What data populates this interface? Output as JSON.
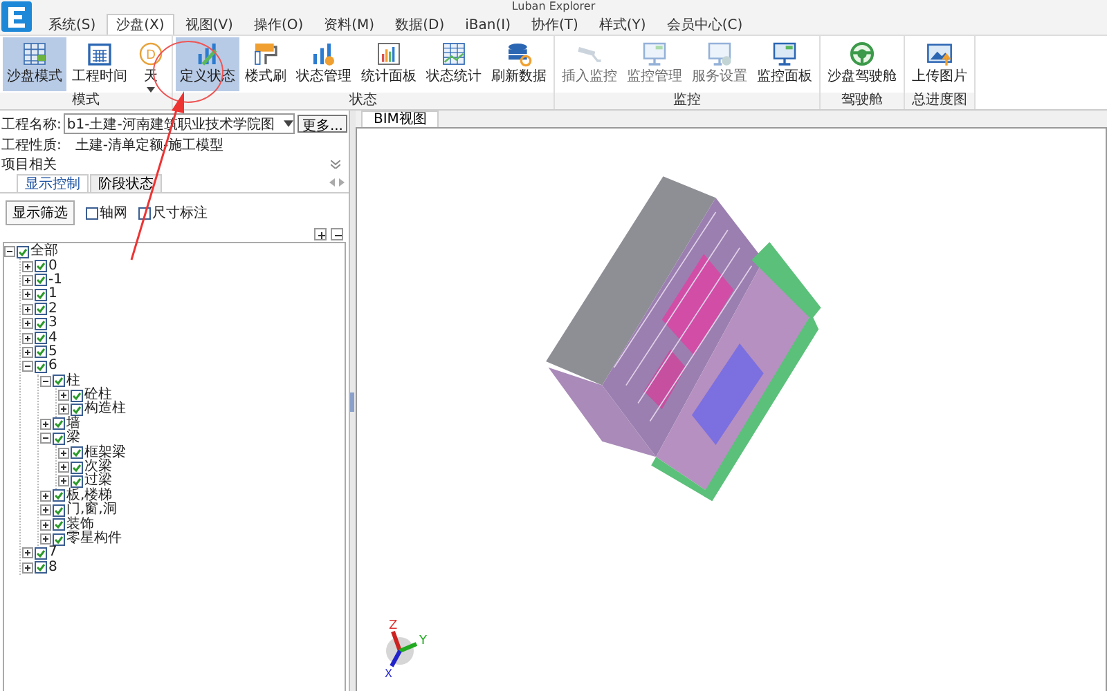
{
  "window": {
    "title": "Luban Explorer"
  },
  "menu_tabs": [
    {
      "label": "系统(S)",
      "selected": false
    },
    {
      "label": "沙盘(X)",
      "selected": true
    },
    {
      "label": "视图(V)",
      "selected": false
    },
    {
      "label": "操作(O)",
      "selected": false
    },
    {
      "label": "资料(M)",
      "selected": false
    },
    {
      "label": "数据(D)",
      "selected": false
    },
    {
      "label": "iBan(I)",
      "selected": false
    },
    {
      "label": "协作(T)",
      "selected": false
    },
    {
      "label": "样式(Y)",
      "selected": false
    },
    {
      "label": "会员中心(C)",
      "selected": false
    }
  ],
  "ribbon": {
    "groups": [
      {
        "label": "模式",
        "buttons": [
          {
            "label": "沙盘模式",
            "kind": "button",
            "selected": true,
            "disabled": false
          },
          {
            "label": "工程时间",
            "kind": "button",
            "selected": false,
            "disabled": false
          },
          {
            "label": "天",
            "kind": "dropdown",
            "icon_text": "D",
            "selected": false,
            "disabled": false
          }
        ]
      },
      {
        "label": "状态",
        "buttons": [
          {
            "label": "定义状态",
            "kind": "button",
            "selected": true,
            "disabled": false
          },
          {
            "label": "楼式刷",
            "kind": "button",
            "selected": false,
            "disabled": false
          },
          {
            "label": "状态管理",
            "kind": "button",
            "selected": false,
            "disabled": false
          },
          {
            "label": "统计面板",
            "kind": "button",
            "selected": false,
            "disabled": false
          },
          {
            "label": "状态统计",
            "kind": "button",
            "selected": false,
            "disabled": false
          },
          {
            "label": "刷新数据",
            "kind": "button",
            "selected": false,
            "disabled": false
          }
        ]
      },
      {
        "label": "监控",
        "buttons": [
          {
            "label": "插入监控",
            "kind": "button",
            "selected": false,
            "disabled": true
          },
          {
            "label": "监控管理",
            "kind": "button",
            "selected": false,
            "disabled": true
          },
          {
            "label": "服务设置",
            "kind": "button",
            "selected": false,
            "disabled": true
          },
          {
            "label": "监控面板",
            "kind": "button",
            "selected": false,
            "disabled": false
          }
        ]
      },
      {
        "label": "驾驶舱",
        "buttons": [
          {
            "label": "沙盘驾驶舱",
            "kind": "button",
            "selected": false,
            "disabled": false
          }
        ]
      },
      {
        "label": "总进度图",
        "buttons": [
          {
            "label": "上传图片",
            "kind": "button",
            "selected": false,
            "disabled": false
          }
        ]
      }
    ]
  },
  "left_panel": {
    "project_name_label": "工程名称:",
    "project_name": "b1-土建-河南建筑职业技术学院图",
    "more_button": "更多...",
    "project_type_label": "工程性质:",
    "project_type": "土建-清单定额-施工模型",
    "section": "项目相关",
    "tabs": [
      {
        "label": "显示控制",
        "selected": true
      },
      {
        "label": "阶段状态",
        "selected": false
      }
    ],
    "filter_button": "显示筛选",
    "options": [
      {
        "label": "轴网",
        "checked": false
      },
      {
        "label": "尺寸标注",
        "checked": false
      }
    ],
    "tree": [
      {
        "label": "全部",
        "checked": true,
        "expanded": true,
        "children": [
          {
            "label": "0",
            "checked": true,
            "expanded": false
          },
          {
            "label": "-1",
            "checked": true,
            "expanded": false
          },
          {
            "label": "1",
            "checked": true,
            "expanded": false
          },
          {
            "label": "2",
            "checked": true,
            "expanded": false
          },
          {
            "label": "3",
            "checked": true,
            "expanded": false
          },
          {
            "label": "4",
            "checked": true,
            "expanded": false
          },
          {
            "label": "5",
            "checked": true,
            "expanded": false
          },
          {
            "label": "6",
            "checked": true,
            "expanded": true,
            "children": [
              {
                "label": "柱",
                "checked": true,
                "expanded": true,
                "children": [
                  {
                    "label": "砼柱",
                    "checked": true,
                    "expanded": false
                  },
                  {
                    "label": "构造柱",
                    "checked": true,
                    "expanded": false
                  }
                ]
              },
              {
                "label": "墙",
                "checked": true,
                "expanded": false
              },
              {
                "label": "梁",
                "checked": true,
                "expanded": true,
                "children": [
                  {
                    "label": "框架梁",
                    "checked": true,
                    "expanded": false
                  },
                  {
                    "label": "次梁",
                    "checked": true,
                    "expanded": false
                  },
                  {
                    "label": "过梁",
                    "checked": true,
                    "expanded": false
                  }
                ]
              },
              {
                "label": "板,楼梯",
                "checked": true,
                "expanded": false
              },
              {
                "label": "门,窗,洞",
                "checked": true,
                "expanded": false
              },
              {
                "label": "装饰",
                "checked": true,
                "expanded": false
              },
              {
                "label": "零星构件",
                "checked": true,
                "expanded": false
              }
            ]
          },
          {
            "label": "7",
            "checked": true,
            "expanded": false
          },
          {
            "label": "8",
            "checked": true,
            "expanded": false
          }
        ]
      }
    ]
  },
  "view": {
    "tab": "BIM视图",
    "axes": [
      "Z",
      "Y",
      "X"
    ]
  }
}
